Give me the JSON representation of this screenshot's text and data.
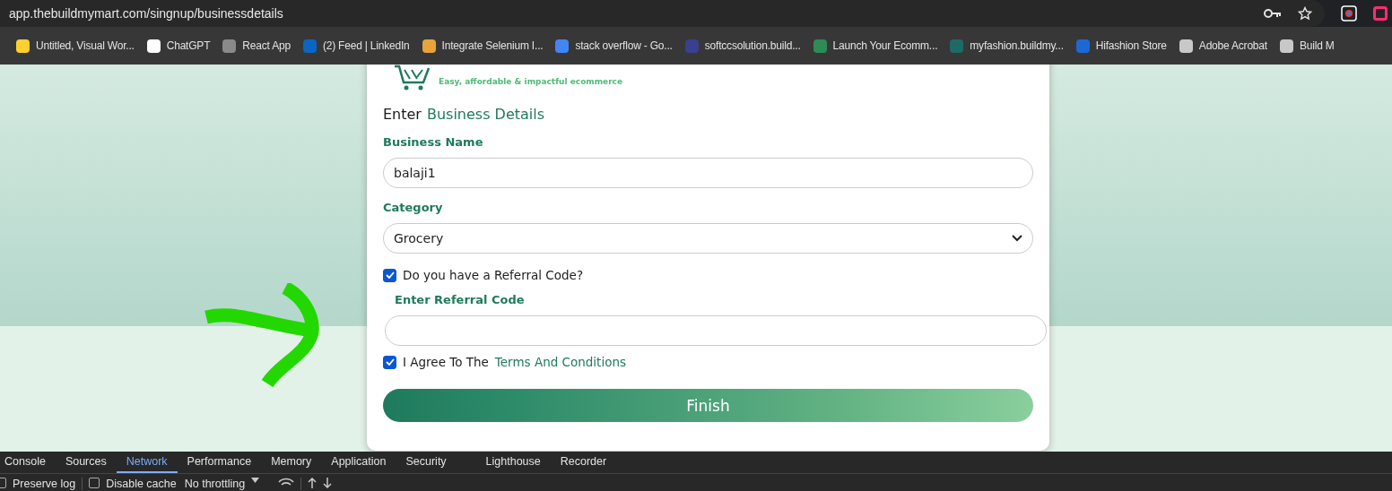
{
  "browser": {
    "url": "app.thebuildmymart.com/singnup/businessdetails",
    "bookmarks": [
      {
        "label": "Untitled, Visual Wor...",
        "color": "#ffd02f"
      },
      {
        "label": "ChatGPT",
        "color": "#ffffff"
      },
      {
        "label": "React App",
        "color": "#8a8a8a"
      },
      {
        "label": "(2) Feed | LinkedIn",
        "color": "#0a66c2"
      },
      {
        "label": "Integrate Selenium I...",
        "color": "#e8a33a"
      },
      {
        "label": "stack overflow - Go...",
        "color": "#4285f4"
      },
      {
        "label": "softccsolution.build...",
        "color": "#3b3f8f"
      },
      {
        "label": "Launch Your Ecomm...",
        "color": "#2e8b57"
      },
      {
        "label": "myfashion.buildmy...",
        "color": "#1e6a66"
      },
      {
        "label": "Hifashion Store",
        "color": "#1c69d4"
      },
      {
        "label": "Adobe Acrobat",
        "color": "#c8c8c8"
      },
      {
        "label": "Build M",
        "color": "#c8c8c8"
      }
    ]
  },
  "page": {
    "tagline": "Easy, affordable & impactful ecommerce",
    "heading_lead": "Enter",
    "heading_accent": "Business Details",
    "business_name": {
      "label": "Business Name",
      "value": "balaji1"
    },
    "category": {
      "label": "Category",
      "value": "Grocery"
    },
    "referral": {
      "label": "Do you have a Referral Code?",
      "checked": true,
      "field_label": "Enter Referral Code"
    },
    "terms": {
      "lead": "I Agree To The",
      "link": "Terms And Conditions",
      "checked": true
    },
    "submit": "Finish"
  },
  "devtools": {
    "tabs": [
      {
        "label": "Console",
        "selected": false
      },
      {
        "label": "Sources",
        "selected": false
      },
      {
        "label": "Network",
        "selected": true
      },
      {
        "label": "Performance",
        "selected": false
      },
      {
        "label": "Memory",
        "selected": false
      },
      {
        "label": "Application",
        "selected": false
      },
      {
        "label": "Security",
        "selected": false
      },
      {
        "label": "Lighthouse",
        "selected": false
      },
      {
        "label": "Recorder",
        "selected": false
      }
    ],
    "preserve_log": {
      "label": "Preserve log",
      "checked": false
    },
    "disable_cache": {
      "label": "Disable cache",
      "checked": false
    },
    "throttling": "No throttling"
  }
}
